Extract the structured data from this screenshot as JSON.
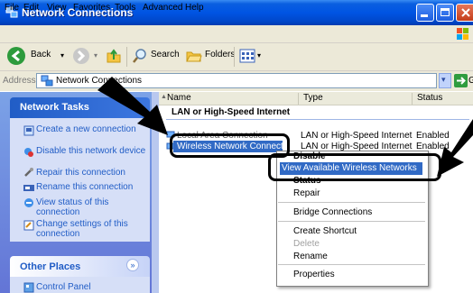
{
  "window": {
    "title": "Network Connections"
  },
  "menubar": {
    "items": [
      "File",
      "Edit",
      "View",
      "Favorites",
      "Tools",
      "Advanced",
      "Help"
    ]
  },
  "toolbar": {
    "back_label": "Back",
    "search_label": "Search",
    "folders_label": "Folders"
  },
  "addressbar": {
    "label": "Address",
    "value": "Network Connections",
    "go_label": "Go"
  },
  "taskpane": {
    "network_tasks_title": "Network Tasks",
    "tasks": [
      "Create a new connection",
      "Disable this network device",
      "Repair this connection",
      "Rename this connection",
      "View status of this connection",
      "Change settings of this connection"
    ],
    "other_places_title": "Other Places",
    "other_places_items": [
      "Control Panel"
    ]
  },
  "list": {
    "columns": [
      "Name",
      "Type",
      "Status"
    ],
    "group": "LAN or High-Speed Internet",
    "rows": [
      {
        "name": "Local Area Connection",
        "type": "LAN or High-Speed Internet",
        "status": "Enabled"
      },
      {
        "name": "Wireless Network Connection",
        "type": "LAN or High-Speed Internet",
        "status": "Enabled"
      }
    ]
  },
  "context_menu": {
    "items": [
      {
        "label": "Disable",
        "bold": false
      },
      {
        "label": "View Available Wireless Networks",
        "highlighted": true
      },
      {
        "label": "Status",
        "bold": true
      },
      {
        "label": "Repair"
      },
      {
        "label": "Bridge Connections"
      },
      {
        "label": "Create Shortcut"
      },
      {
        "label": "Delete",
        "disabled": true
      },
      {
        "label": "Rename"
      },
      {
        "label": "Properties"
      }
    ]
  },
  "colors": {
    "titlebar": "#0054e3",
    "selection": "#316ac5",
    "taskpane": "#6375d6",
    "link": "#215dc6"
  }
}
